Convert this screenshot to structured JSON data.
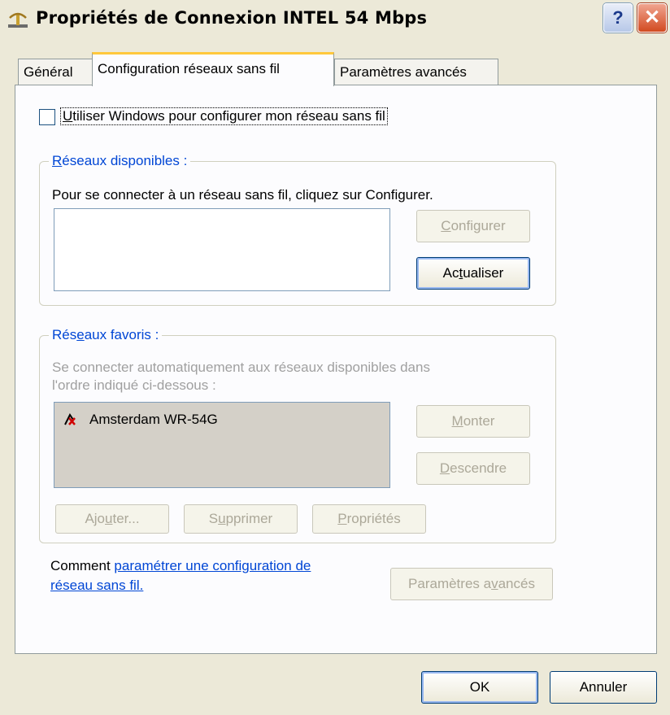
{
  "window": {
    "title": "Propriétés de Connexion INTEL 54 Mbps",
    "help": "?",
    "close": "✕"
  },
  "tabs": [
    {
      "label": "Général"
    },
    {
      "label": "Configuration réseaux sans fil"
    },
    {
      "label": "Paramètres avancés"
    }
  ],
  "use_windows": {
    "pre": "",
    "accel": "U",
    "rest": "tiliser Windows pour configurer mon réseau sans fil",
    "checked": false
  },
  "available": {
    "title_accel": "R",
    "title_rest": "éseaux disponibles :",
    "description": "Pour se connecter à un réseau sans fil, cliquez sur Configurer.",
    "configure": {
      "accel": "C",
      "rest": "onfigurer"
    },
    "refresh": {
      "pre": "Ac",
      "accel": "t",
      "rest": "ualiser"
    }
  },
  "favorites": {
    "title_pre": "Rés",
    "title_accel": "e",
    "title_rest": "aux favoris :",
    "description_line1": "Se connecter automatiquement aux réseaux disponibles dans",
    "description_line2": "l'ordre indiqué ci-dessous :",
    "items": [
      {
        "name": "Amsterdam WR-54G"
      }
    ],
    "up": {
      "accel": "M",
      "rest": "onter"
    },
    "down": {
      "accel": "D",
      "rest": "escendre"
    },
    "add": {
      "pre": "Ajo",
      "accel": "u",
      "rest": "ter..."
    },
    "remove": {
      "pre": "S",
      "accel": "u",
      "rest": "pprimer"
    },
    "properties": {
      "accel": "P",
      "rest": "ropriétés"
    }
  },
  "help_text": {
    "prefix": "Comment ",
    "link_line1": "paramétrer une configuration de",
    "link_line2": "réseau sans fil."
  },
  "advanced_button": {
    "pre": "Paramètres a",
    "accel": "v",
    "rest": "ancés"
  },
  "footer": {
    "ok": "OK",
    "cancel": "Annuler"
  },
  "colors": {
    "accent_blue": "#0046d5",
    "tab_highlight": "#ffc83c",
    "close_red": "#d24a20"
  }
}
